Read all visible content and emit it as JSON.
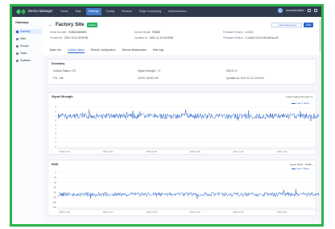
{
  "topbar": {
    "brand": "Device Manager",
    "nav": [
      "Home",
      "Map",
      "Settings",
      "Config",
      "Sensors",
      "Edge Computing",
      "Administration"
    ],
    "active_index": 2,
    "user": "dmadmin@abc"
  },
  "sidebar": {
    "title": "Gateways",
    "items": [
      "Gateway",
      "Sites",
      "Groups",
      "Tasks",
      "Statistics"
    ],
    "active_index": 0
  },
  "header": {
    "back": "←",
    "title": "Factory Site",
    "status": "Online",
    "assign_label": "Add Assignment",
    "edit_label": "Edit",
    "info": {
      "serial_label": "Serial Number:",
      "serial_value": "SN920234WK5",
      "created_label": "Created At:",
      "created_value": "2021-10-11 00:00:00",
      "model_label": "Device Model:",
      "model_value": "R1555",
      "updated_label": "Updated At:",
      "updated_value": "2021-11-12 14:25:08",
      "firmware_label": "Firmware Version:",
      "firmware_value": "1.0.5.2",
      "firmware_ver_label": "Firmware Version:",
      "firmware_ver_value": "1.3.6a.5.V3.0-6.33.cs9.zu-s3"
    }
  },
  "tabs": {
    "items": [
      "Basic Info",
      "Cellular Signal",
      "Remote Configuration",
      "Remote Maintenance",
      "Web logs"
    ],
    "active_index": 1
  },
  "summary": {
    "title": "Summary",
    "fields": [
      {
        "label": "Cellular Status:",
        "value": "LTE"
      },
      {
        "label": "Signal Strength:",
        "value": "-71"
      },
      {
        "label": "SIM ID:",
        "value": "8"
      },
      {
        "label": "PCI:",
        "value": "148"
      },
      {
        "label": "Cell ID:",
        "value": "80012345"
      },
      {
        "label": "Updated At:",
        "value": "2021-11-12 14:00:00"
      }
    ]
  },
  "signal_chart": {
    "title": "Signal Strength",
    "meta": "Latest Signal Strength: 9",
    "legend": "Last 7 Days",
    "y_ticks": [
      "9",
      "8",
      "7",
      "6",
      "5",
      "4",
      "3",
      "2",
      "1",
      "0"
    ],
    "x_ticks": [
      "2021-11-06",
      "2021-11-07",
      "2021-11-08",
      "2021-11-09",
      "2021-11-10",
      "2021-11-11"
    ]
  },
  "rsrp_chart": {
    "title": "RSSI",
    "meta": "Latest RSSI: -75dBm",
    "legend": "Last 7 Days",
    "y_ticks": [
      "0",
      "-20",
      "-40",
      "-60",
      "-80",
      "-100",
      "-120",
      "-140"
    ],
    "x_ticks": [
      "2021-11-06",
      "2021-11-07",
      "2021-11-08",
      "2021-11-09",
      "2021-11-10",
      "2021-11-11"
    ]
  },
  "colors": {
    "accent": "#2b66c8",
    "topbar": "#2f3b4c",
    "frame": "#2cb34a",
    "online": "#29b464"
  }
}
